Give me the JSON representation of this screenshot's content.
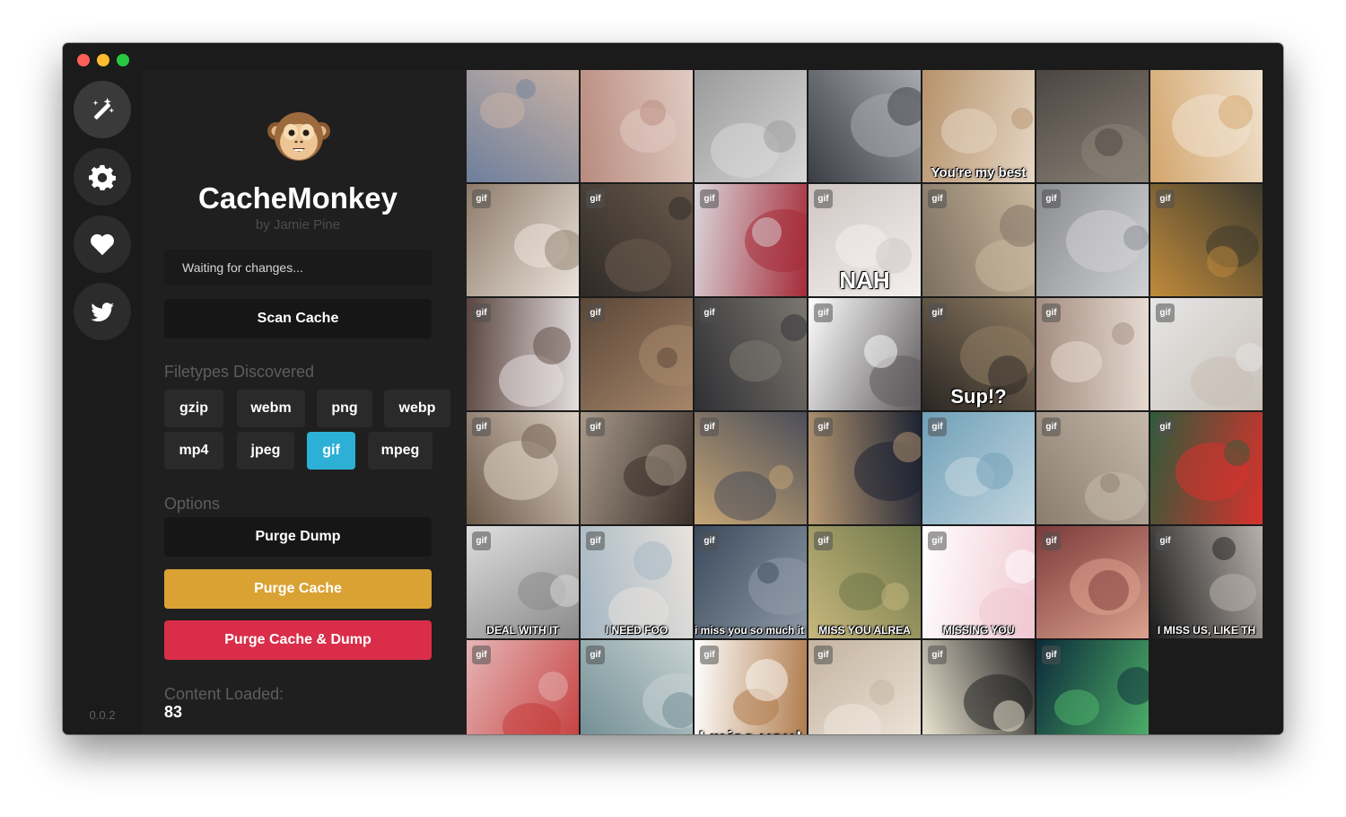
{
  "app": {
    "title": "CacheMonkey",
    "author": "by Jamie Pine",
    "version": "0.0.2"
  },
  "sidebar": {
    "icons": [
      "magic-wand-icon",
      "gear-icon",
      "heart-icon",
      "twitter-icon"
    ]
  },
  "status": {
    "text": "Waiting for changes..."
  },
  "actions": {
    "scan_label": "Scan Cache",
    "purge_dump_label": "Purge Dump",
    "purge_cache_label": "Purge Cache",
    "purge_both_label": "Purge Cache & Dump"
  },
  "filetypes": {
    "heading": "Filetypes Discovered",
    "items": [
      {
        "label": "gzip",
        "selected": false
      },
      {
        "label": "webm",
        "selected": false
      },
      {
        "label": "png",
        "selected": false
      },
      {
        "label": "webp",
        "selected": false
      },
      {
        "label": "mp4",
        "selected": false
      },
      {
        "label": "jpeg",
        "selected": false
      },
      {
        "label": "gif",
        "selected": true
      },
      {
        "label": "mpeg",
        "selected": false
      }
    ]
  },
  "options": {
    "heading": "Options"
  },
  "content": {
    "label": "Content Loaded:",
    "count": "83"
  },
  "colors": {
    "accent": "#2db0d6",
    "purge_cache": "#d9a233",
    "purge_both": "#d92d49"
  },
  "gallery": {
    "badge": "gif",
    "tiles": [
      {
        "caption": "",
        "badge": false,
        "bg": [
          "#6d7f9c",
          "#c9b2a5"
        ]
      },
      {
        "caption": "",
        "badge": false,
        "bg": [
          "#b98b7f",
          "#e0cbc2"
        ]
      },
      {
        "caption": "",
        "badge": false,
        "bg": [
          "#9a9a9a",
          "#d8d8d8"
        ]
      },
      {
        "caption": "",
        "badge": false,
        "bg": [
          "#3b3e45",
          "#a6a9ad"
        ]
      },
      {
        "caption": "You're my best",
        "badge": false,
        "bg": [
          "#b6926b",
          "#e5d6c3"
        ]
      },
      {
        "caption": "",
        "badge": false,
        "bg": [
          "#4b4541",
          "#8b8277"
        ]
      },
      {
        "caption": "",
        "badge": false,
        "bg": [
          "#d3a56c",
          "#f0e2cf"
        ]
      },
      {
        "caption": "",
        "badge": true,
        "bg": [
          "#8d7b6a",
          "#ece4dc"
        ]
      },
      {
        "caption": "",
        "badge": true,
        "bg": [
          "#2e2a27",
          "#6a5a4c"
        ]
      },
      {
        "caption": "",
        "badge": true,
        "bg": [
          "#d9d6db",
          "#a52b38"
        ]
      },
      {
        "caption": "NAH",
        "badge": true,
        "bg": [
          "#cfc6c3",
          "#f3efee"
        ]
      },
      {
        "caption": "",
        "badge": true,
        "bg": [
          "#7c6f5f",
          "#c9b89e"
        ]
      },
      {
        "caption": "",
        "badge": true,
        "bg": [
          "#8a8b8f",
          "#d1d2d6"
        ]
      },
      {
        "caption": "",
        "badge": true,
        "bg": [
          "#c08a3b",
          "#3e3b2e"
        ]
      },
      {
        "caption": "",
        "badge": true,
        "bg": [
          "#5b4640",
          "#e5dfe0"
        ]
      },
      {
        "caption": "",
        "badge": true,
        "bg": [
          "#5a4637",
          "#a6866a"
        ]
      },
      {
        "caption": "",
        "badge": true,
        "bg": [
          "#2f2f33",
          "#7b7770"
        ]
      },
      {
        "caption": "",
        "badge": true,
        "bg": [
          "#ffffff",
          "#5e5a5c"
        ]
      },
      {
        "caption": "Sup!?",
        "badge": true,
        "bg": [
          "#2a2623",
          "#8f7c62"
        ]
      },
      {
        "caption": "",
        "badge": true,
        "bg": [
          "#a28b7e",
          "#e7dbd2"
        ]
      },
      {
        "caption": "",
        "badge": true,
        "bg": [
          "#e6e6e6",
          "#c8c0b7"
        ]
      },
      {
        "caption": "",
        "badge": true,
        "bg": [
          "#6b5848",
          "#ddd1c5"
        ]
      },
      {
        "caption": "",
        "badge": true,
        "bg": [
          "#a8998a",
          "#3a302a"
        ]
      },
      {
        "caption": "",
        "badge": true,
        "bg": [
          "#c6a675",
          "#4c4e59"
        ]
      },
      {
        "caption": "",
        "badge": true,
        "bg": [
          "#b99a74",
          "#1d2333"
        ]
      },
      {
        "caption": "",
        "badge": true,
        "bg": [
          "#6fa0b8",
          "#c2d5df"
        ]
      },
      {
        "caption": "",
        "badge": true,
        "bg": [
          "#8b7c6d",
          "#c5b9ab"
        ]
      },
      {
        "caption": "",
        "badge": true,
        "bg": [
          "#2f5b3a",
          "#d9312d"
        ]
      },
      {
        "caption": "DEAL WITH IT",
        "badge": true,
        "bg": [
          "#dedede",
          "#8a8a8a"
        ]
      },
      {
        "caption": "I NEED FOO",
        "badge": true,
        "bg": [
          "#a4b6c3",
          "#e8e2dc"
        ]
      },
      {
        "caption": "i miss you so much it hurts",
        "badge": true,
        "bg": [
          "#3a4a5c",
          "#8f9aa7"
        ]
      },
      {
        "caption": "MISS YOU ALREA",
        "badge": true,
        "bg": [
          "#c7b77d",
          "#6e7749"
        ]
      },
      {
        "caption": "MISSING YOU",
        "badge": true,
        "bg": [
          "#ffffff",
          "#f1c8d3"
        ]
      },
      {
        "caption": "",
        "badge": true,
        "bg": [
          "#7b3a3a",
          "#dca18e"
        ]
      },
      {
        "caption": "I MISS US, LIKE TH",
        "badge": true,
        "bg": [
          "#1d1d1d",
          "#b8b0aa"
        ]
      },
      {
        "caption": "",
        "badge": true,
        "bg": [
          "#e6b5b6",
          "#c43c3b"
        ]
      },
      {
        "caption": "",
        "badge": true,
        "bg": [
          "#6c8a8f",
          "#c7d2d4"
        ]
      },
      {
        "caption": "I miss you!",
        "badge": true,
        "bg": [
          "#ffffff",
          "#b07b4c"
        ]
      },
      {
        "caption": "",
        "badge": true,
        "bg": [
          "#c4b39f",
          "#efe6dc"
        ]
      },
      {
        "caption": "",
        "badge": true,
        "bg": [
          "#f3ecd8",
          "#222222"
        ]
      },
      {
        "caption": "",
        "badge": true,
        "bg": [
          "#0c2a3a",
          "#4fb46a"
        ]
      }
    ]
  }
}
